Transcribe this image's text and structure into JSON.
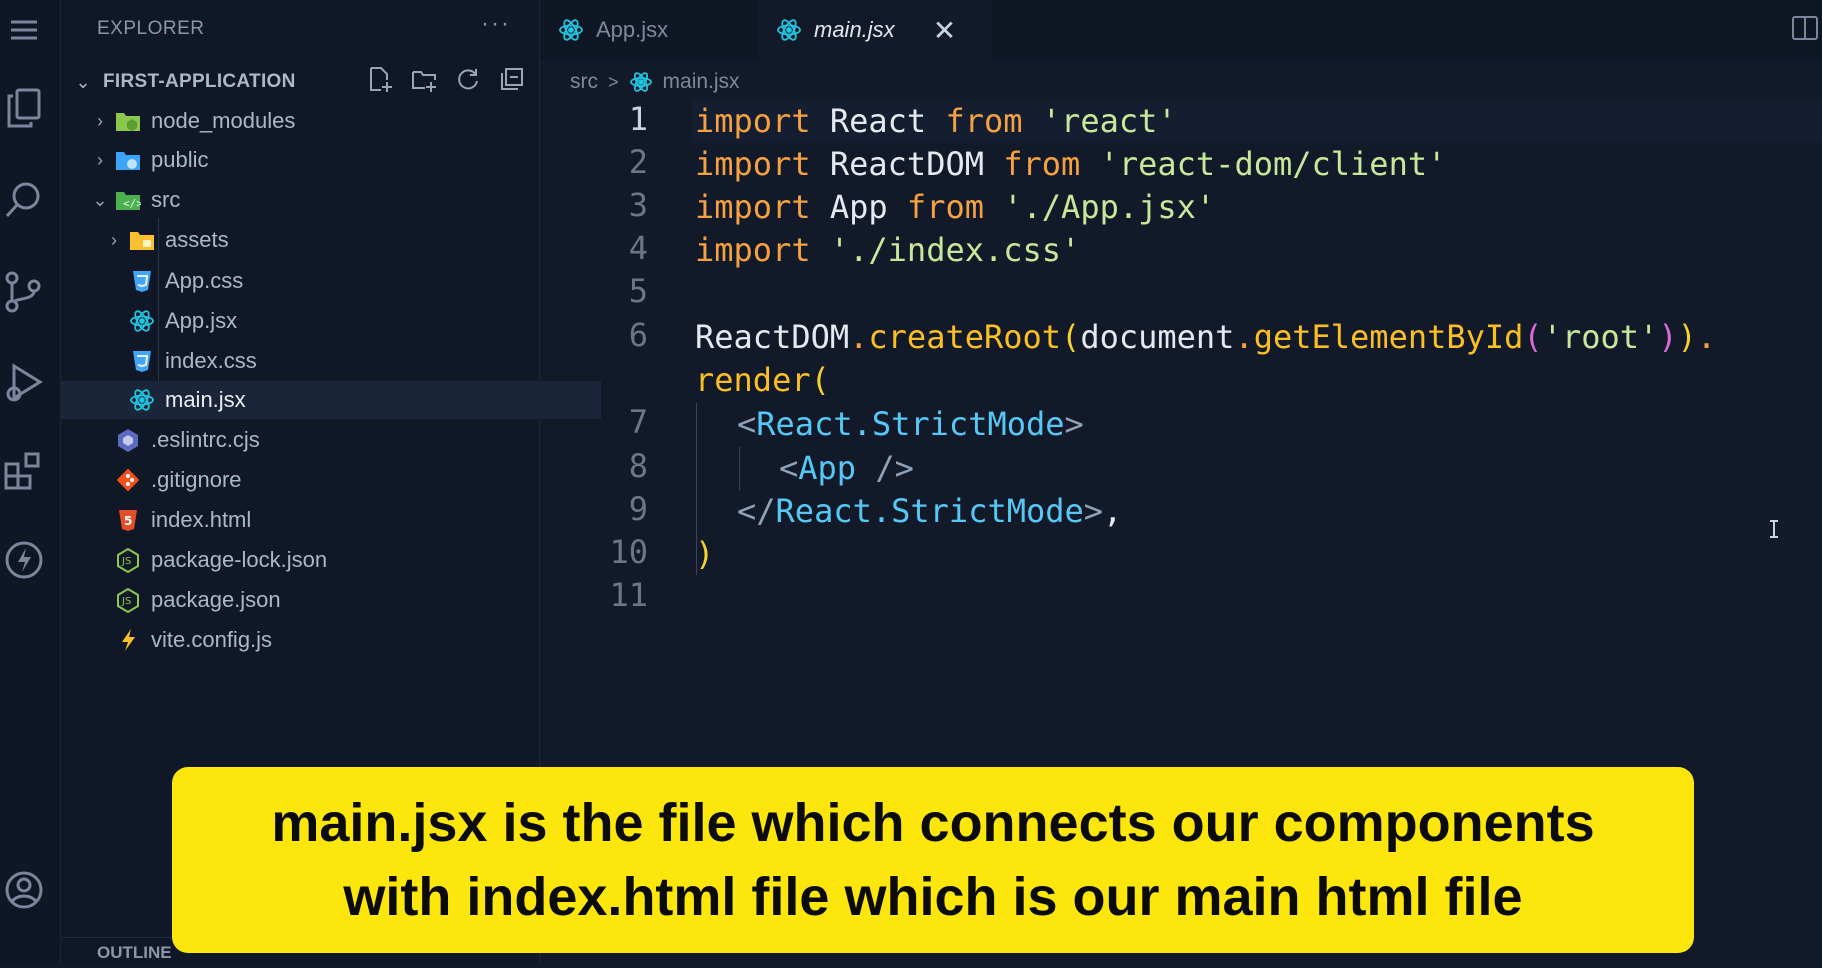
{
  "explorer": {
    "title": "EXPLORER",
    "more": "···",
    "root": "FIRST-APPLICATION",
    "items": [
      {
        "label": "node_modules",
        "kind": "folder",
        "expanded": false,
        "icon": "node-folder-icon",
        "color": "#8cc84b"
      },
      {
        "label": "public",
        "kind": "folder",
        "expanded": false,
        "icon": "public-folder-icon",
        "color": "#3ba4f6"
      },
      {
        "label": "src",
        "kind": "folder",
        "expanded": true,
        "icon": "src-folder-icon",
        "color": "#4caf50"
      },
      {
        "label": "assets",
        "kind": "folder",
        "expanded": false,
        "icon": "assets-folder-icon",
        "color": "#fbc02d"
      },
      {
        "label": "App.css",
        "kind": "file",
        "icon": "css-icon",
        "color": "#42a5f5"
      },
      {
        "label": "App.jsx",
        "kind": "file",
        "icon": "react-icon",
        "color": "#22c4e0"
      },
      {
        "label": "index.css",
        "kind": "file",
        "icon": "css-icon",
        "color": "#42a5f5"
      },
      {
        "label": "main.jsx",
        "kind": "file",
        "icon": "react-icon",
        "color": "#22c4e0",
        "selected": true
      },
      {
        "label": ".eslintrc.cjs",
        "kind": "file",
        "icon": "eslint-icon",
        "color": "#5c6bc0"
      },
      {
        "label": ".gitignore",
        "kind": "file",
        "icon": "git-icon",
        "color": "#f4511e"
      },
      {
        "label": "index.html",
        "kind": "file",
        "icon": "html-icon",
        "color": "#e44d26"
      },
      {
        "label": "package-lock.json",
        "kind": "file",
        "icon": "nodejs-icon",
        "color": "#8cc84b"
      },
      {
        "label": "package.json",
        "kind": "file",
        "icon": "nodejs-icon",
        "color": "#8cc84b"
      },
      {
        "label": "vite.config.js",
        "kind": "file",
        "icon": "vite-icon",
        "color": "#fbc02d"
      }
    ],
    "outline": "OUTLINE"
  },
  "tabs": [
    {
      "label": "App.jsx",
      "active": false
    },
    {
      "label": "main.jsx",
      "active": true,
      "close": "✕"
    }
  ],
  "breadcrumb": {
    "folder": "src",
    "sep": ">",
    "file": "main.jsx"
  },
  "code": {
    "line_numbers": [
      "1",
      "2",
      "3",
      "4",
      "5",
      "6",
      "7",
      "8",
      "9",
      "10",
      "11"
    ],
    "l1": {
      "kw": "import",
      "id": "React",
      "from": "from",
      "str": "'react'"
    },
    "l2": {
      "kw": "import",
      "id": "ReactDOM",
      "from": "from",
      "str": "'react-dom/client'"
    },
    "l3": {
      "kw": "import",
      "id": "App",
      "from": "from",
      "str": "'./App.jsx'"
    },
    "l4": {
      "kw": "import",
      "str": "'./index.css'"
    },
    "l6": {
      "obj": "ReactDOM",
      "dot": ".",
      "fn": "createRoot",
      "p1": "(",
      "arg": "document",
      "dot2": ".",
      "fn2": "getElementById",
      "p2": "(",
      "str": "'root'",
      "p3": ")",
      "p4": ")",
      "dot3": "."
    },
    "l6b": {
      "fn": "render",
      "p": "("
    },
    "l7": {
      "open": "<",
      "tag": "React.StrictMode",
      "close": ">"
    },
    "l8": {
      "open": "<",
      "tag": "App",
      "close": " />"
    },
    "l9": {
      "open": "</",
      "tag": "React.StrictMode",
      "close": ">",
      "comma": ","
    },
    "l10": {
      "p": ")"
    }
  },
  "caption": {
    "line1": "main.jsx is the file which connects our components",
    "line2": "with index.html file which is our main html file"
  },
  "colors": {
    "caption_bg": "#fde60b",
    "keyword": "#f5a142",
    "string": "#c7e89a",
    "tag": "#56c8f5"
  }
}
